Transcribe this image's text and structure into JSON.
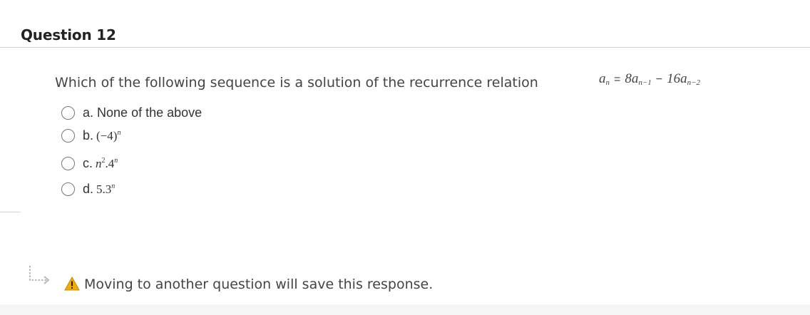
{
  "question": {
    "title": "Question 12",
    "prompt": "Which of the following  sequence is a solution of the recurrence relation",
    "relation": {
      "lhs": "a",
      "lhs_sub": "n",
      "equals": "=",
      "term1": "8a",
      "term1_sub": "n−1",
      "minus": "−",
      "term2": "16a",
      "term2_sub": "n−2"
    }
  },
  "options": [
    {
      "letter": "a.",
      "text": "None of the above",
      "selected": false
    },
    {
      "letter": "b.",
      "math_base": "(−4)",
      "math_exp": "n",
      "selected": false
    },
    {
      "letter": "c.",
      "math_base": "n",
      "math_exp": "2",
      "math_tail": ".4",
      "math_tail_exp": "n",
      "selected": false
    },
    {
      "letter": "d.",
      "math_base": "5.3",
      "math_exp": "n",
      "selected": false
    }
  ],
  "footer": {
    "notice": "Moving to another question will save this response."
  },
  "icons": {
    "arrow": "return-arrow-icon",
    "warning": "warning-icon",
    "warning_color": "#f0ad00"
  }
}
